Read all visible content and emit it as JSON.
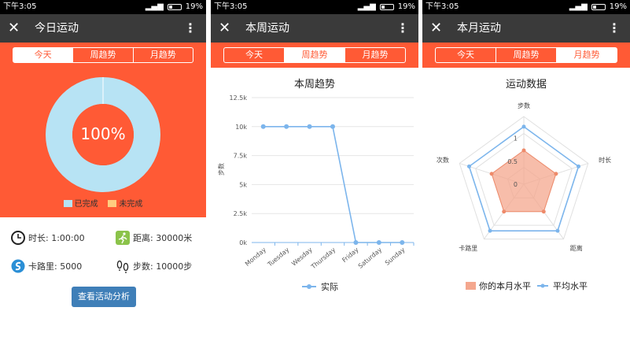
{
  "status": {
    "time": "下午3:05",
    "battery": "19%"
  },
  "panel1": {
    "title": "今日运动",
    "tabs": [
      "今天",
      "周趋势",
      "月趋势"
    ],
    "donut_label": "100%",
    "completion": 100,
    "legend": [
      "已完成",
      "未完成"
    ],
    "stats": {
      "duration": "时长: 1:00:00",
      "distance": "距离: 30000米",
      "calories": "卡路里: 5000",
      "steps": "步数: 10000步"
    },
    "button": "查看活动分析"
  },
  "panel2": {
    "title": "本周运动",
    "tabs": [
      "今天",
      "周趋势",
      "月趋势"
    ],
    "chart_title": "本周趋势",
    "legend": "实际"
  },
  "panel3": {
    "title": "本月运动",
    "tabs": [
      "今天",
      "周趋势",
      "月趋势"
    ],
    "chart_title": "运动数据",
    "legend": [
      "你的本月水平",
      "平均水平"
    ]
  },
  "colors": {
    "accent": "#ff5a35",
    "appbar": "#3a3a3a",
    "donut_done": "#b7e3f4",
    "donut_todo": "#ffcc80",
    "line": "#7cb5ec",
    "radar_fill": "#f4a78e",
    "button": "#3f7fb8"
  },
  "chart_data": [
    {
      "type": "line",
      "title": "本周趋势",
      "ylabel": "步数",
      "categories": [
        "Monday",
        "Tuesday",
        "Wesday",
        "Thursday",
        "Friday",
        "Saturday",
        "Sunday"
      ],
      "series": [
        {
          "name": "实际",
          "values": [
            10000,
            10000,
            10000,
            10000,
            0,
            0,
            0
          ]
        }
      ],
      "yticks": [
        "0k",
        "2.5k",
        "5k",
        "7.5k",
        "10k",
        "12.5k"
      ],
      "ylim": [
        0,
        12500
      ]
    },
    {
      "type": "radar",
      "title": "运动数据",
      "categories": [
        "步数",
        "时长",
        "距离",
        "卡路里",
        "次数"
      ],
      "rticks": [
        "0",
        "0.5",
        "1"
      ],
      "series": [
        {
          "name": "你的本月水平",
          "values": [
            0.5,
            0.5,
            0.5,
            0.5,
            0.5
          ]
        },
        {
          "name": "平均水平",
          "values": [
            0.85,
            0.85,
            0.85,
            0.85,
            0.85
          ]
        }
      ]
    }
  ]
}
